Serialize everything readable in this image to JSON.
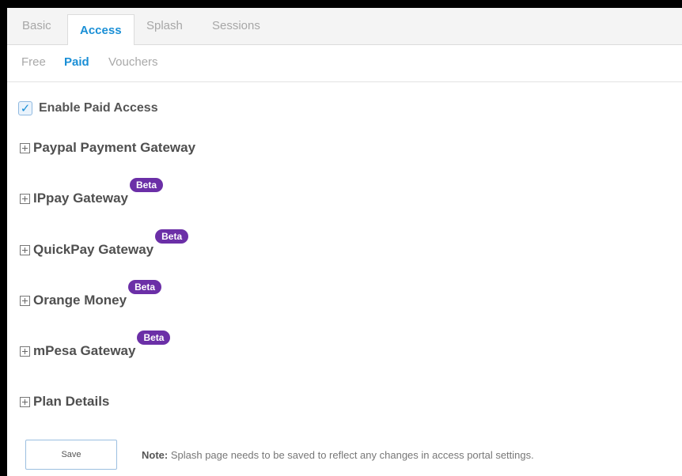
{
  "tabs": [
    {
      "label": "Basic",
      "active": false
    },
    {
      "label": "Access",
      "active": true
    },
    {
      "label": "Splash",
      "active": false
    },
    {
      "label": "Sessions",
      "active": false
    }
  ],
  "subtabs": [
    {
      "label": "Free",
      "active": false
    },
    {
      "label": "Paid",
      "active": true
    },
    {
      "label": "Vouchers",
      "active": false
    }
  ],
  "enable_paid": {
    "label": "Enable Paid Access",
    "checked": true
  },
  "sections": [
    {
      "label": "Paypal Payment Gateway",
      "badge": ""
    },
    {
      "label": "IPpay Gateway",
      "badge": "Beta"
    },
    {
      "label": "QuickPay Gateway",
      "badge": "Beta"
    },
    {
      "label": "Orange Money",
      "badge": "Beta"
    },
    {
      "label": "mPesa Gateway",
      "badge": "Beta"
    },
    {
      "label": "Plan Details",
      "badge": ""
    }
  ],
  "footer": {
    "save_label": "Save",
    "note_label": "Note:",
    "note_text": "Splash page needs to be saved to reflect any changes in access portal settings."
  },
  "colors": {
    "accent": "#1a8fd6",
    "beta": "#6b2fa7"
  },
  "icons": {
    "checkbox": "check-icon",
    "section_toggle": "plus-box-icon"
  }
}
